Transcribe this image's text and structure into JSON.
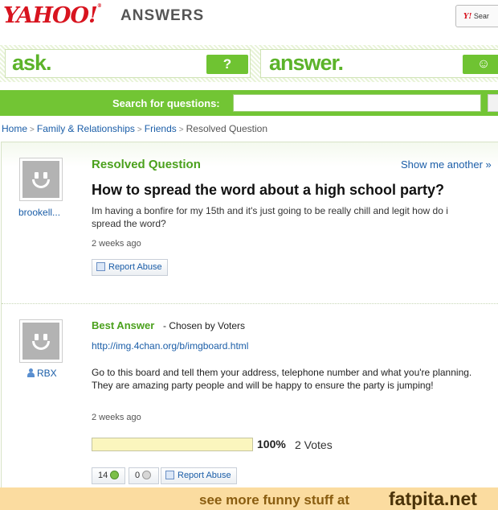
{
  "header": {
    "logo": "YAHOO!",
    "logo_reg": "®",
    "section": "ANSWERS",
    "search_snippet": "Sear",
    "search_snippet_mark": "Y!"
  },
  "bars": {
    "ask_label": "ask.",
    "ask_icon": "?",
    "answer_label": "answer.",
    "answer_icon": "☺"
  },
  "search": {
    "label": "Search for questions:",
    "placeholder": ""
  },
  "breadcrumb": {
    "items": [
      "Home",
      "Family & Relationships",
      "Friends"
    ],
    "current": "Resolved Question",
    "separator": ">"
  },
  "question": {
    "status": "Resolved Question",
    "show_another": "Show me another »",
    "title": "How to spread the word about a high school party?",
    "body": "Im having a bonfire for my 15th and it's just going to be really chill and legit how do i spread the word?",
    "time": "2 weeks ago",
    "asker": "brookell...",
    "report_label": "Report Abuse"
  },
  "answer": {
    "best_label": "Best Answer",
    "chosen_by": "- Chosen by Voters",
    "link": "http://img.4chan.org/b/imgboard.html",
    "body": "Go to this board and tell them your address, telephone number and what you're planning. They are amazing party people and will be happy to ensure the party is jumping!",
    "time": "2 weeks ago",
    "answerer": "RBX",
    "vote_fraction": 1.0,
    "vote_percent": "100%",
    "vote_count": "2 Votes",
    "thumbs_up": "14",
    "thumbs_down": "0",
    "report_label": "Report Abuse"
  },
  "footer": {
    "text": "see more funny stuff at",
    "site": "fatpita.net"
  },
  "colors": {
    "brand_red": "#d8141f",
    "yahoo_green": "#72c534",
    "title_green": "#4ba11d",
    "link_blue": "#1b5ea8"
  }
}
